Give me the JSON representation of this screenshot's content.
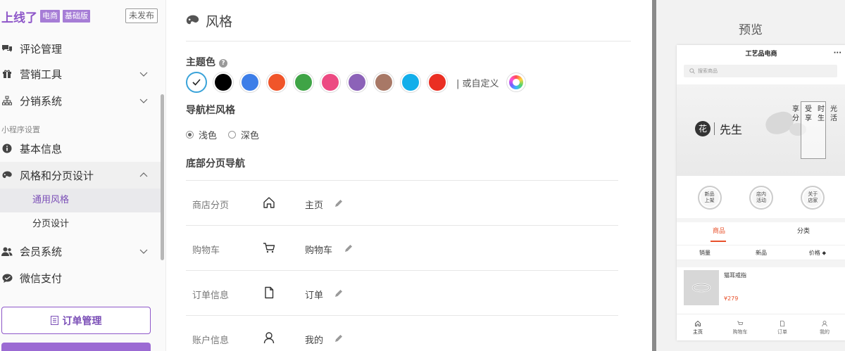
{
  "sidebar": {
    "brand": "上线了",
    "tags": [
      "电商",
      "基础版"
    ],
    "unpublished": "未发布",
    "items": [
      {
        "label": "评论管理"
      },
      {
        "label": "营销工具"
      },
      {
        "label": "分销系统"
      }
    ],
    "section_label": "小程序设置",
    "settings_items": [
      {
        "label": "基本信息"
      },
      {
        "label": "风格和分页设计"
      }
    ],
    "sub_items": [
      {
        "label": "通用风格"
      },
      {
        "label": "分页设计"
      }
    ],
    "more_items": [
      {
        "label": "会员系统"
      },
      {
        "label": "微信支付"
      }
    ],
    "order_button": "订单管理"
  },
  "main": {
    "title": "风格",
    "theme_label": "主题色",
    "swatches": [
      "#ffffff",
      "#000000",
      "#3d7ee8",
      "#f0552a",
      "#3fa446",
      "#ec4a82",
      "#8c62b8",
      "#a87866",
      "#13aeea",
      "#ea2f23"
    ],
    "custom_label": "| 或自定义",
    "navbar_label": "导航栏风格",
    "navbar_options": [
      "浅色",
      "深色"
    ],
    "bottom_nav_label": "底部分页导航",
    "nav_rows": [
      {
        "category": "商店分页",
        "icon": "home-icon",
        "name": "主页"
      },
      {
        "category": "购物车",
        "icon": "cart-icon",
        "name": "购物车"
      },
      {
        "category": "订单信息",
        "icon": "document-icon",
        "name": "订单"
      },
      {
        "category": "账户信息",
        "icon": "user-icon",
        "name": "我的"
      }
    ]
  },
  "preview": {
    "title": "预览",
    "phone": {
      "shop_name": "工艺品电商",
      "more": "···",
      "search_placeholder": "搜索商品",
      "banner_mark": "花",
      "banner_text": "先生",
      "banner_vertical": [
        "享分",
        "受享",
        "时生",
        "光活"
      ],
      "circles": [
        "新品\n上架",
        "店内\n活动",
        "关于\n店家"
      ],
      "tabs": [
        "商品",
        "分类"
      ],
      "sort": [
        "销量",
        "新品",
        "价格 ⬥"
      ],
      "product_name": "猫耳戒指",
      "product_price": "¥279",
      "bottom_nav": [
        "主页",
        "购物车",
        "订单",
        "我的"
      ]
    }
  },
  "colors": {
    "accent": "#8e57c9",
    "selected_ring": "#3aa3d9",
    "phone_accent": "#e8512b"
  }
}
